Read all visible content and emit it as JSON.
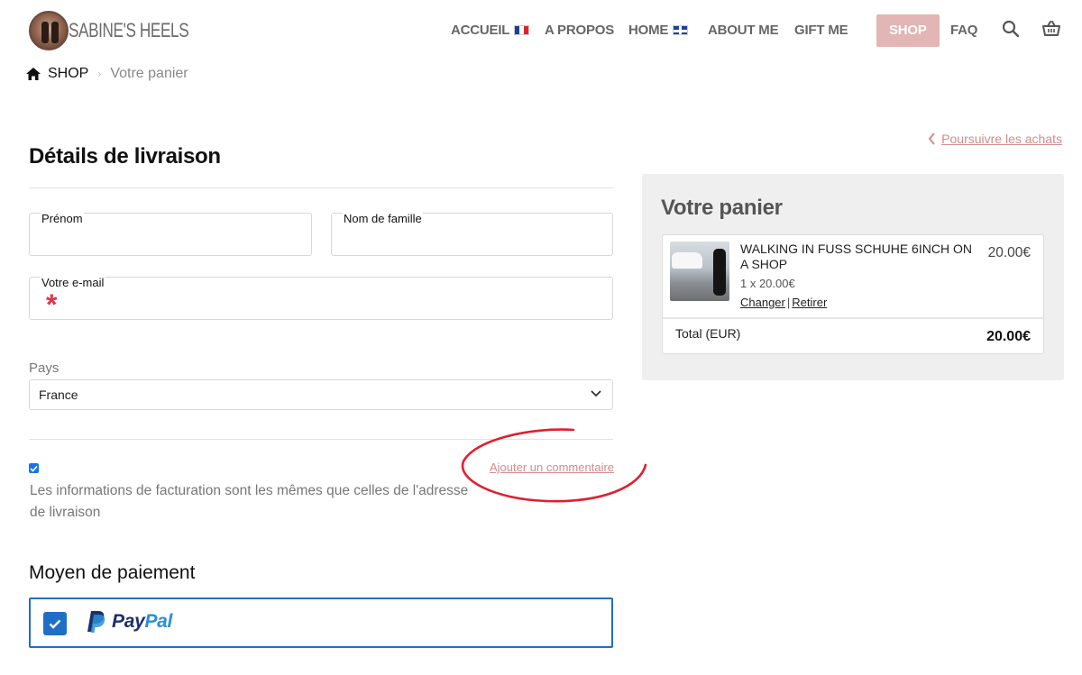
{
  "brand": {
    "name": "SABINE'S HEELS"
  },
  "nav": {
    "items": [
      {
        "label": "ACCUEIL",
        "flag": "fr"
      },
      {
        "label": "A PROPOS"
      },
      {
        "label": "HOME",
        "flag": "uk"
      },
      {
        "label": "ABOUT ME"
      },
      {
        "label": "GIFT ME"
      },
      {
        "label": "SHOP",
        "active": true
      },
      {
        "label": "FAQ"
      }
    ],
    "icons": [
      "search-icon",
      "basket-icon"
    ]
  },
  "breadcrumb": {
    "home": "SHOP",
    "separator": "›",
    "current": "Votre panier"
  },
  "continue_link": "Poursuivre les achats",
  "shipping": {
    "title": "Détails de livraison",
    "first_name": {
      "label": "Prénom",
      "value": ""
    },
    "last_name": {
      "label": "Nom de famille",
      "value": ""
    },
    "email": {
      "label": "Votre e-mail",
      "value": "",
      "required_mark": "*"
    },
    "country": {
      "label": "Pays",
      "value": "France"
    }
  },
  "billing": {
    "same_as_shipping_checked": true,
    "text": "Les informations de facturation sont les mêmes que celles de l'adresse de livraison",
    "comment_link": "Ajouter un commentaire"
  },
  "payment": {
    "title": "Moyen de paiement",
    "method": {
      "brand_part1": "Pay",
      "brand_part2": "Pal",
      "selected": true
    }
  },
  "cart": {
    "title": "Votre panier",
    "item": {
      "name": "WALKING IN FUSS SCHUHE 6INCH ON A SHOP",
      "price": "20.00€",
      "quantity": "1 x 20.00€",
      "change": "Changer",
      "remove": "Retirer",
      "action_separator": "|"
    },
    "total_label": "Total (EUR)",
    "total_value": "20.00€"
  },
  "colors": {
    "accent_pink": "#e3b5b5",
    "link_pink": "#d48a8a",
    "selected_blue": "#1f6fc5",
    "annotation_red": "#e0202e"
  }
}
